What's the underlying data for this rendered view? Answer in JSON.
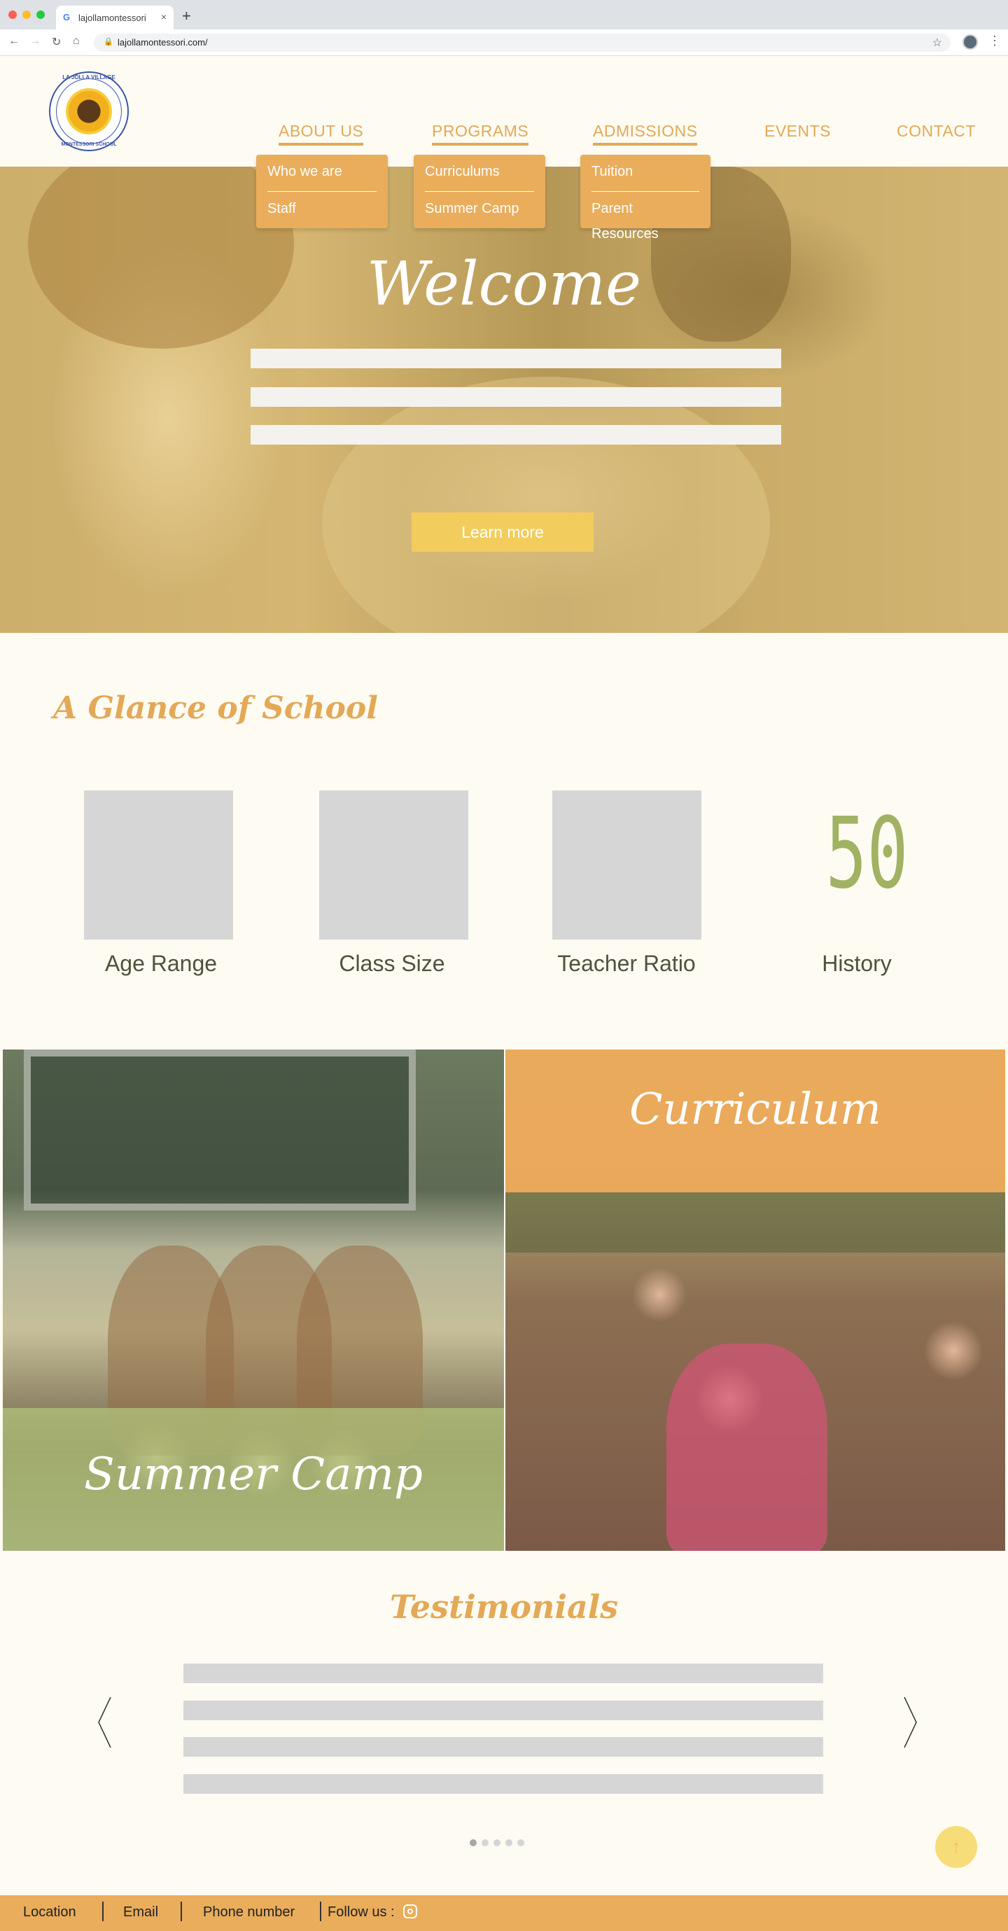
{
  "browser": {
    "tab_title": "lajollamontessori",
    "tab_close": "×",
    "new_tab": "+",
    "url": "lajollamontessori.com/",
    "back": "←",
    "forward": "→",
    "reload": "↻",
    "home": "⌂",
    "lock": "🔒",
    "star": "☆",
    "menu": "⋮"
  },
  "logo": {
    "top_text": "LA JOLLA VILLAGE",
    "bottom_text": "MONTESSORI SCHOOL"
  },
  "nav": {
    "items": [
      {
        "label": "ABOUT US",
        "active": true
      },
      {
        "label": "PROGRAMS",
        "active": true
      },
      {
        "label": "ADMISSIONS",
        "active": true
      },
      {
        "label": "EVENTS",
        "active": false
      },
      {
        "label": "CONTACT",
        "active": false
      }
    ],
    "dropdowns": {
      "about": [
        "Who we are",
        "Staff"
      ],
      "programs": [
        "Curriculums",
        "Summer Camp"
      ],
      "admissions": [
        "Tuition",
        "Parent Resources"
      ]
    }
  },
  "hero": {
    "title": "Welcome",
    "button": "Learn more"
  },
  "glance": {
    "title": "A Glance of School",
    "stats": [
      {
        "label": "Age Range"
      },
      {
        "label": "Class Size"
      },
      {
        "label": "Teacher Ratio"
      },
      {
        "label": "History",
        "value": "50"
      }
    ]
  },
  "programs": {
    "summer_camp": "Summer Camp",
    "curriculum": "Curriculum"
  },
  "testimonials": {
    "title": "Testimonials",
    "prev": "‹",
    "next": "›",
    "slide_count": 5,
    "active_slide": 1
  },
  "back_to_top": "↑",
  "footer": {
    "location": "Location",
    "email": "Email",
    "phone": "Phone number",
    "follow": "Follow us :"
  },
  "colors": {
    "accent_orange": "#e9ad5c",
    "accent_green": "#a1b264",
    "accent_yellow": "#f2cd5d",
    "background": "#fefbf2"
  },
  "icons": {
    "social": "instagram-icon",
    "to_top": "arrow-up-icon"
  }
}
